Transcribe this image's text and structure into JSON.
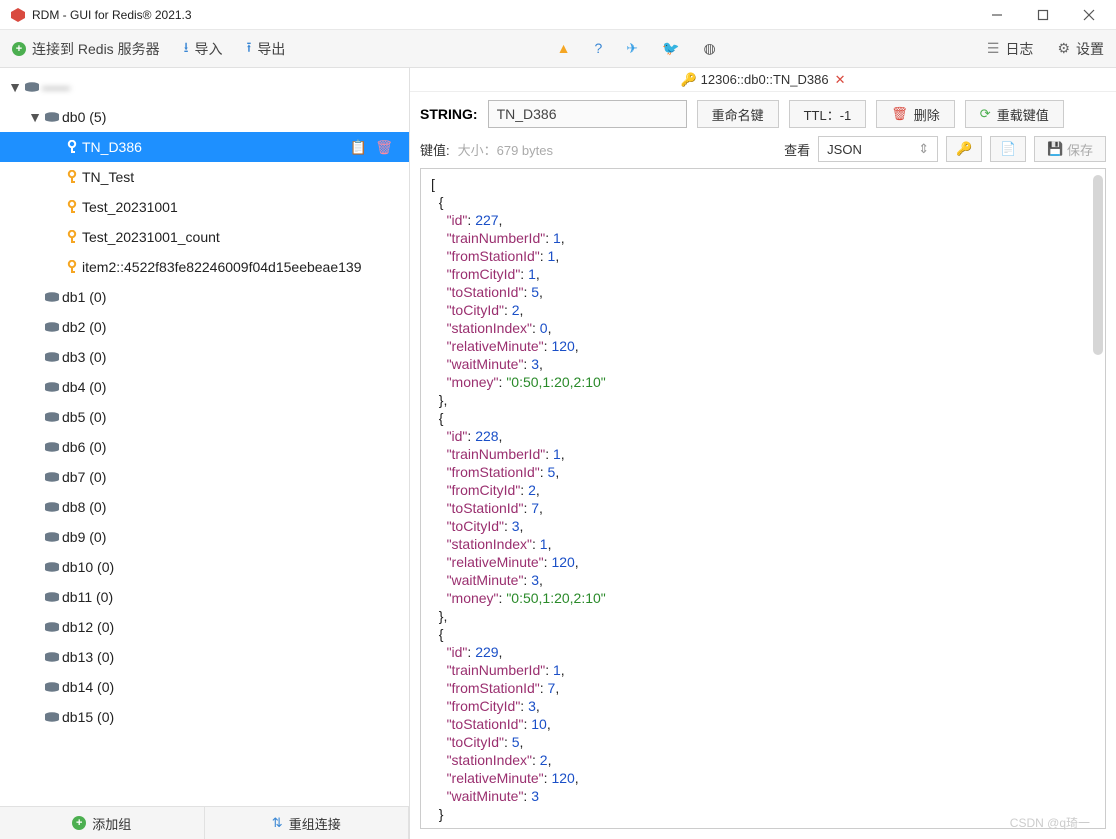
{
  "window": {
    "title": "RDM - GUI for Redis® 2021.3"
  },
  "toolbar": {
    "connect_label": "连接到 Redis 服务器",
    "import_label": "导入",
    "export_label": "导出",
    "log_label": "日志",
    "settings_label": "设置"
  },
  "tree": {
    "server_label": "——",
    "db0_label": "db0  (5)",
    "keys": [
      "TN_D386",
      "TN_Test",
      "Test_20231001",
      "Test_20231001_count",
      "item2::4522f83fe82246009f04d15eebeae139"
    ],
    "other_dbs": [
      "db1  (0)",
      "db2  (0)",
      "db3  (0)",
      "db4  (0)",
      "db5  (0)",
      "db6  (0)",
      "db7  (0)",
      "db8  (0)",
      "db9  (0)",
      "db10  (0)",
      "db11  (0)",
      "db12  (0)",
      "db13  (0)",
      "db14  (0)",
      "db15  (0)"
    ],
    "add_group_label": "添加组",
    "regroup_label": "重组连接"
  },
  "tab": {
    "prefix": "12306::db0::",
    "key": "TN_D386"
  },
  "key_panel": {
    "type_label": "STRING:",
    "key_value": "TN_D386",
    "rename_label": "重命名键",
    "ttl_label": "TTL：-1",
    "delete_label": "删除",
    "reload_label": "重载键值"
  },
  "value_panel": {
    "label": "键值:",
    "size_label": "大小：679 bytes",
    "view_label": "查看",
    "format": "JSON",
    "save_label": "保存"
  },
  "json_value": [
    {
      "id": 227,
      "trainNumberId": 1,
      "fromStationId": 1,
      "fromCityId": 1,
      "toStationId": 5,
      "toCityId": 2,
      "stationIndex": 0,
      "relativeMinute": 120,
      "waitMinute": 3,
      "money": "0:50,1:20,2:10"
    },
    {
      "id": 228,
      "trainNumberId": 1,
      "fromStationId": 5,
      "fromCityId": 2,
      "toStationId": 7,
      "toCityId": 3,
      "stationIndex": 1,
      "relativeMinute": 120,
      "waitMinute": 3,
      "money": "0:50,1:20,2:10"
    },
    {
      "id": 229,
      "trainNumberId": 1,
      "fromStationId": 7,
      "fromCityId": 3,
      "toStationId": 10,
      "toCityId": 5,
      "stationIndex": 2,
      "relativeMinute": 120,
      "waitMinute": 3
    }
  ],
  "watermark": "CSDN @q琦一",
  "colors": {
    "accent": "#1e90ff",
    "key_icon": "#f5a623"
  }
}
